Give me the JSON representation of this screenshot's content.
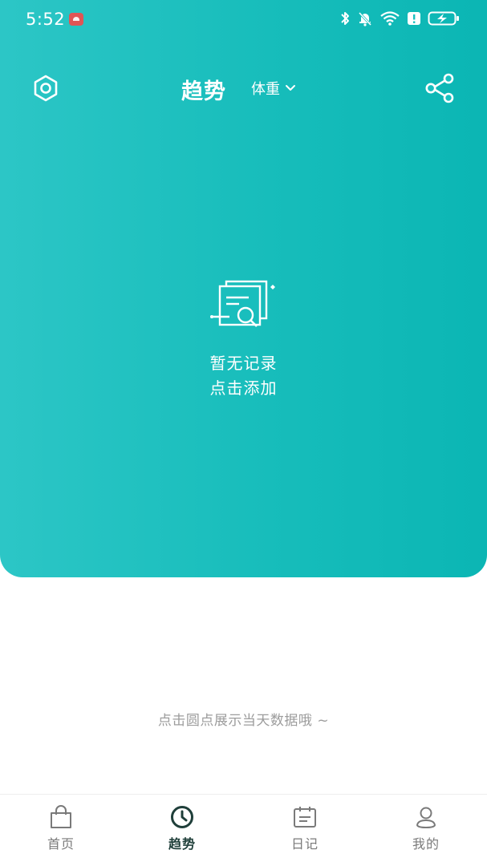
{
  "status_bar": {
    "time": "5:52"
  },
  "header": {
    "title": "趋势",
    "metric_selected": "体重"
  },
  "empty_state": {
    "line1": "暂无记录",
    "line2": "点击添加"
  },
  "hint": "点击圆点展示当天数据哦 ~",
  "bottom_nav": {
    "items": [
      {
        "label": "首页",
        "icon": "shopping-bag-icon",
        "active": false
      },
      {
        "label": "趋势",
        "icon": "clock-icon",
        "active": true
      },
      {
        "label": "日记",
        "icon": "calendar-icon",
        "active": false
      },
      {
        "label": "我的",
        "icon": "user-icon",
        "active": false
      }
    ]
  },
  "colors": {
    "accent": "#17bdbb",
    "active_nav": "#1f3f3a",
    "inactive_nav": "#7a7a7a",
    "hint_text": "#9c9c9c"
  }
}
